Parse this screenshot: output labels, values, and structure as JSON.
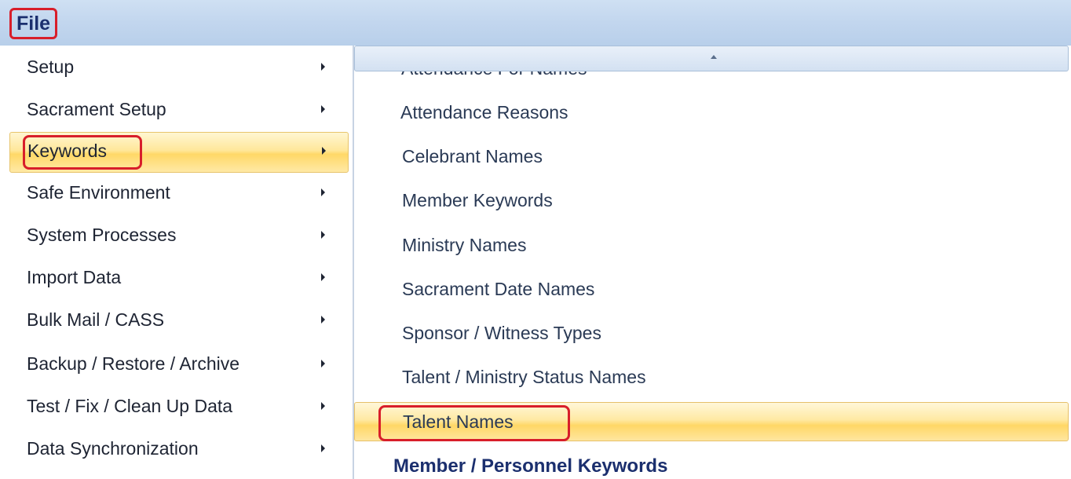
{
  "menubar": {
    "file_label": "File"
  },
  "left_menu": {
    "items": [
      {
        "label": "Setup"
      },
      {
        "label": "Sacrament Setup"
      },
      {
        "label": "Keywords"
      },
      {
        "label": "Safe Environment"
      },
      {
        "label": "System Processes"
      },
      {
        "label": "Import Data"
      },
      {
        "label": "Bulk Mail / CASS"
      },
      {
        "label": "Backup / Restore / Archive"
      },
      {
        "label": "Test / Fix / Clean Up Data"
      },
      {
        "label": "Data Synchronization"
      }
    ],
    "highlighted": "Keywords"
  },
  "submenu": {
    "partial_item": "Attendance For Names",
    "items": [
      {
        "label": "Attendance Reasons"
      },
      {
        "label": "Celebrant Names"
      },
      {
        "label": "Member Keywords"
      },
      {
        "label": "Ministry Names"
      },
      {
        "label": "Sacrament Date Names"
      },
      {
        "label": "Sponsor / Witness Types"
      },
      {
        "label": "Talent / Ministry Status Names"
      },
      {
        "label": "Talent Names"
      }
    ],
    "highlighted": "Talent Names",
    "section_header": "Member / Personnel Keywords"
  },
  "colors": {
    "menubar": "#c2d6ee",
    "highlight": "#ffd867",
    "annotation_red": "#d81e2a",
    "header_text": "#1b2f6e"
  }
}
